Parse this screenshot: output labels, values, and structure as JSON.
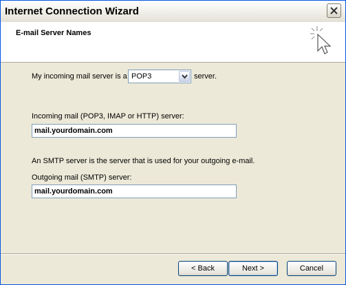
{
  "window": {
    "title": "Internet Connection Wizard",
    "close_label": "×"
  },
  "header": {
    "title": "E-mail Server Names",
    "icon": "wizard-sparkle-cursor-icon"
  },
  "server_type": {
    "prefix_label": "My incoming mail server is a",
    "selected_value": "POP3",
    "suffix_label": "server."
  },
  "incoming": {
    "label": "Incoming mail (POP3, IMAP or HTTP) server:",
    "value": "mail.yourdomain.com"
  },
  "smtp_info": "An SMTP server is the server that is used for your outgoing e-mail.",
  "outgoing": {
    "label": "Outgoing mail (SMTP) server:",
    "value": "mail.yourdomain.com"
  },
  "buttons": {
    "back": "< Back",
    "next": "Next >",
    "cancel": "Cancel"
  },
  "colors": {
    "dialog_bg": "#ece9d8",
    "header_bg": "#ffffff",
    "input_border": "#7f9db9",
    "button_border": "#003c74"
  }
}
